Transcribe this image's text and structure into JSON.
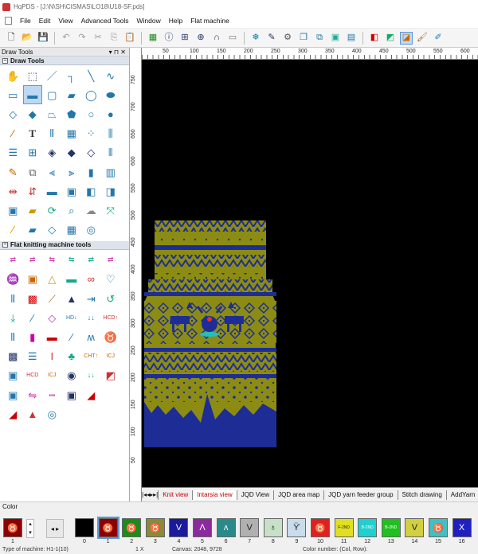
{
  "window": {
    "title": "HqPDS - [J:\\N\\SH\\CISMAS\\LO18\\U18-SF.pds]"
  },
  "menu": [
    "File",
    "Edit",
    "View",
    "Advanced Tools",
    "Window",
    "Help",
    "Flat machine"
  ],
  "draw_panel": {
    "title": "Draw Tools",
    "pin": "▾ ⊓ ✕",
    "section1": "Draw Tools",
    "section2": "Flat knitting machine tools"
  },
  "ruler_top": [
    "50",
    "100",
    "150",
    "200",
    "250",
    "300",
    "350",
    "400",
    "450",
    "500",
    "550",
    "600"
  ],
  "ruler_left": [
    "750",
    "700",
    "650",
    "600",
    "550",
    "500",
    "450",
    "400",
    "350",
    "300",
    "250",
    "200",
    "150",
    "100",
    "50"
  ],
  "tabs": [
    "Knit view",
    "Intarsia view",
    "JQD View",
    "JQD area map",
    "JQD yarn feeder group",
    "Stitch drawing",
    "AddYarn"
  ],
  "active_tab": "Intarsia view",
  "color_panel": {
    "title": "Color",
    "current_number": "1",
    "swatches": [
      {
        "num": "0",
        "color": "#000000",
        "glyph": ""
      },
      {
        "num": "1",
        "color": "#8b0000",
        "glyph": "♉"
      },
      {
        "num": "2",
        "color": "#1a8c1a",
        "glyph": "♉"
      },
      {
        "num": "3",
        "color": "#8a8a3a",
        "glyph": "♉"
      },
      {
        "num": "4",
        "color": "#1a1a9c",
        "glyph": "V"
      },
      {
        "num": "5",
        "color": "#8a2a9c",
        "glyph": "Λ"
      },
      {
        "num": "6",
        "color": "#2a8a8a",
        "glyph": "ʌ"
      },
      {
        "num": "7",
        "color": "#b0b0b0",
        "glyph": "V"
      },
      {
        "num": "8",
        "color": "#c8e0c8",
        "glyph": "♁"
      },
      {
        "num": "9",
        "color": "#c8dcec",
        "glyph": "ϔ"
      },
      {
        "num": "10",
        "color": "#e02020",
        "glyph": "♉"
      },
      {
        "num": "11",
        "color": "#e0e020",
        "glyph": "F-2ND"
      },
      {
        "num": "12",
        "color": "#20d0d0",
        "glyph": "B-2ND"
      },
      {
        "num": "13",
        "color": "#20c020",
        "glyph": "B-2ND"
      },
      {
        "num": "14",
        "color": "#d0d040",
        "glyph": "V"
      },
      {
        "num": "15",
        "color": "#40c0c0",
        "glyph": "♉"
      },
      {
        "num": "16",
        "color": "#2020c0",
        "glyph": "X"
      }
    ]
  },
  "status": {
    "machine": "Type of machine: H1-1(10)",
    "zoom": "1 X",
    "canvas": "Canvas: 2048, 9728",
    "color_number": "Color number: (Col, Row):"
  },
  "colors": {
    "garment_green": "#8c8c14",
    "garment_blue": "#1e2d96",
    "active_tab": "#cc0000"
  }
}
